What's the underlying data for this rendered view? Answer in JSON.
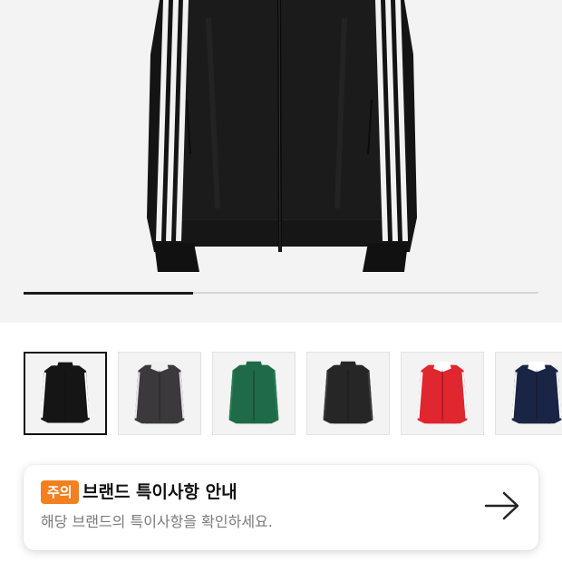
{
  "gallery": {
    "main_image": "black-track-jacket-with-white-three-stripes",
    "current_index": 1,
    "total_images": 3,
    "progress_fraction": 0.33
  },
  "thumbnails": [
    {
      "name": "black-white-stripes",
      "body": "#151515",
      "sleeve": "#151515",
      "stripe": "#ffffff",
      "collar": "#151515",
      "selected": true
    },
    {
      "name": "charcoal-white-collar",
      "body": "#3b393c",
      "sleeve": "#3b393c",
      "stripe": "#e8e8e8",
      "collar": "#f0f0f0",
      "selected": false
    },
    {
      "name": "green",
      "body": "#1f6a48",
      "sleeve": "#1f6a48",
      "stripe": "#2a7d56",
      "collar": "#1f6a48",
      "selected": false
    },
    {
      "name": "dark-grey",
      "body": "#262626",
      "sleeve": "#262626",
      "stripe": "#3d3d3d",
      "collar": "#262626",
      "selected": false
    },
    {
      "name": "red-white",
      "body": "#e0262f",
      "sleeve": "#e0262f",
      "stripe": "#ffffff",
      "collar": "#ffffff",
      "selected": false
    },
    {
      "name": "navy-white",
      "body": "#1a2545",
      "sleeve": "#1a2545",
      "stripe": "#ffffff",
      "collar": "#ffffff",
      "selected": false
    }
  ],
  "notice": {
    "badge": "주의",
    "title": "브랜드 특이사항 안내",
    "description": "해당 브랜드의 특이사항을 확인하세요.",
    "badge_color": "#f2801f",
    "arrow_icon": "arrow-right-icon"
  }
}
